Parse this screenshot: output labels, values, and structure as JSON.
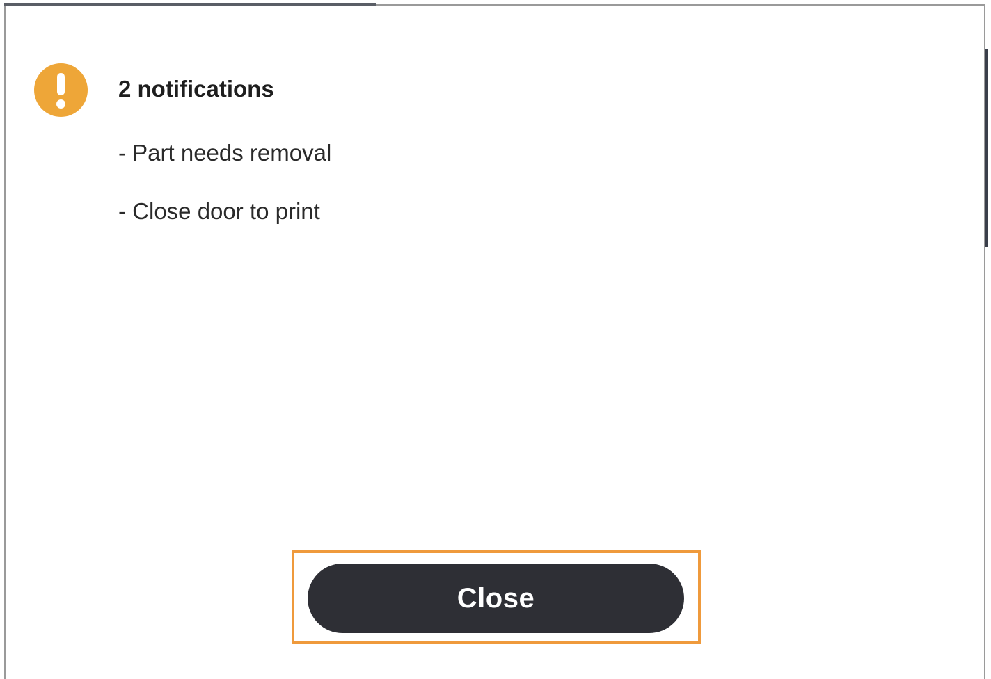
{
  "dialog": {
    "icon": "warning-icon",
    "title": "2 notifications",
    "messages": [
      "- Part needs removal",
      "- Close door to print"
    ],
    "close_label": "Close"
  },
  "colors": {
    "warning": "#eea638",
    "button_bg": "#2e2f35",
    "focus_outline": "#ef9a3c"
  }
}
